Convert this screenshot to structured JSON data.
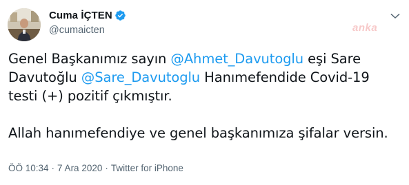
{
  "author": {
    "display_name": "Cuma İÇTEN",
    "handle": "@cumaicten",
    "verified": true
  },
  "watermark": "anka",
  "tweet": {
    "lines": [
      {
        "parts": [
          {
            "text": "Genel Başkanımız sayın ",
            "type": "text"
          },
          {
            "text": "@Ahmet_Davutoglu",
            "type": "mention"
          },
          {
            "text": " eşi Sare",
            "type": "text"
          }
        ]
      },
      {
        "parts": [
          {
            "text": "Davutoğlu ",
            "type": "text"
          },
          {
            "text": "@Sare_Davutoglu",
            "type": "mention"
          },
          {
            "text": " Hanımefendide Covid-19",
            "type": "text"
          }
        ]
      },
      {
        "parts": [
          {
            "text": "testi (+) pozitif çıkmıştır.",
            "type": "text"
          }
        ]
      },
      {
        "parts": [
          {
            "text": "Allah hanımefendiye ve genel başkanımıza şifalar versin.",
            "type": "text"
          }
        ]
      }
    ]
  },
  "meta": {
    "time": "ÖÖ 10:34",
    "separator": "·",
    "date": "7 Ara 2020",
    "source": "Twitter for iPhone"
  },
  "colors": {
    "mention": "#1d9bf0",
    "secondary_text": "#536471",
    "primary_text": "#0f1419",
    "verified_badge": "#1d9bf0"
  },
  "icons": {
    "verified": "verified-badge-icon",
    "more": "chevron-down-icon"
  }
}
